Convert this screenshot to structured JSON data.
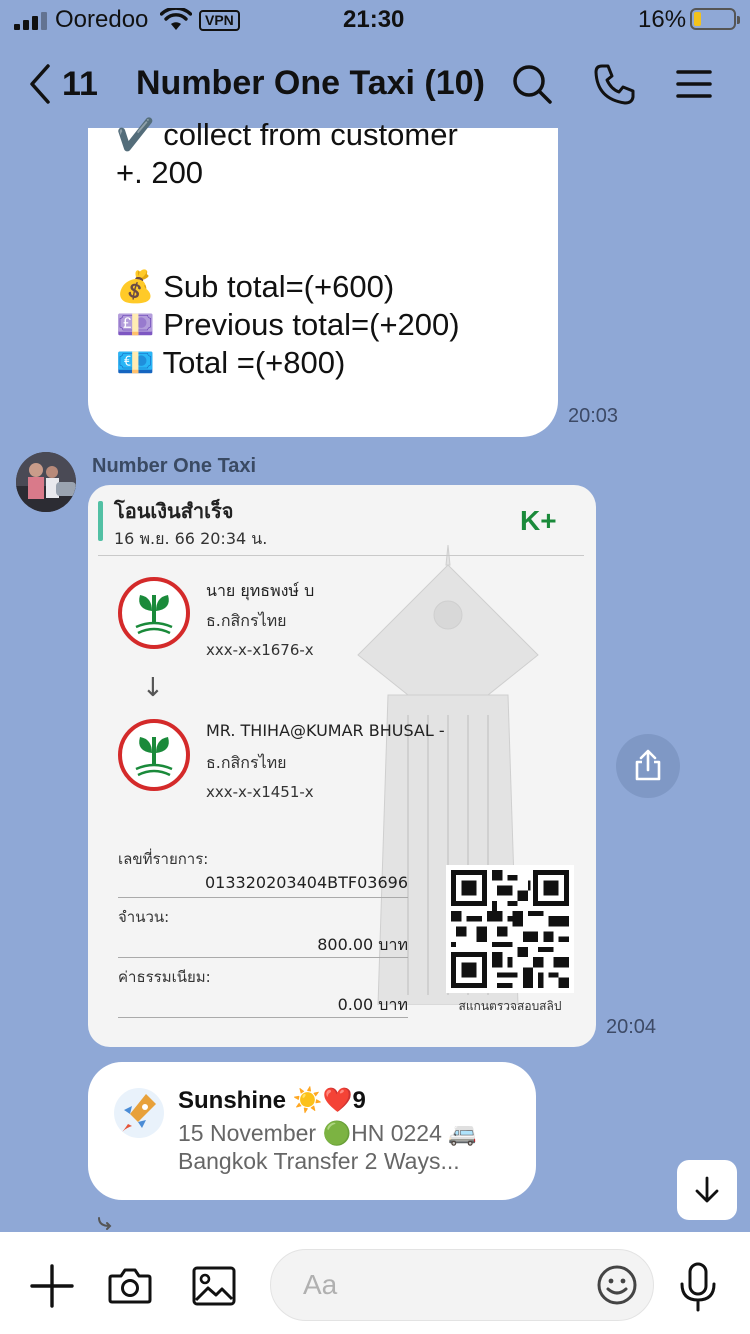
{
  "status_bar": {
    "carrier": "Ooredoo",
    "vpn": "VPN",
    "time": "21:30",
    "battery": "16%",
    "battery_level": 0.16
  },
  "header": {
    "back_count": "11",
    "title": "Number One Taxi (10)",
    "icons": [
      "chevron-left-icon",
      "search-icon",
      "phone-icon",
      "menu-icon"
    ]
  },
  "messages": {
    "m1": {
      "lines": [
        "✔️ collect from customer",
        "+. 200",
        "",
        "",
        "💰 Sub total=(+600)",
        "💷 Previous total=(+200)",
        "💶 Total =(+800)"
      ],
      "time": "20:03"
    },
    "sender": "Number One Taxi",
    "slip": {
      "title": "โอนเงินสำเร็จ",
      "date": "16 พ.ย. 66  20:34 น.",
      "logo": "K+",
      "from_name": "นาย ยุทธพงษ์ บ",
      "from_bank": "ธ.กสิกรไทย",
      "from_account": "xxx-x-x1676-x",
      "to_name": "MR. THIHA@KUMAR BHUSAL -",
      "to_bank": "ธ.กสิกรไทย",
      "to_account": "xxx-x-x1451-x",
      "ref_label": "เลขที่รายการ:",
      "ref_value": "013320203404BTF03696",
      "amount_label": "จำนวน:",
      "amount_value": "800.00 บาท",
      "fee_label": "ค่าธรรมเนียม:",
      "fee_value": "0.00 บาท",
      "qr_caption": "สแกนตรวจสอบสลิป",
      "time": "20:04"
    },
    "m3": {
      "name": "Sunshine ☀️❤️9",
      "line1": "15 November 🟢HN 0224 🚐",
      "line2": "Bangkok Transfer 2 Ways..."
    }
  },
  "input": {
    "placeholder": "Aa"
  },
  "colors": {
    "background": "#8fa8d6",
    "kbank_green": "#1a8a3a",
    "kbank_red": "#d42a2a"
  }
}
